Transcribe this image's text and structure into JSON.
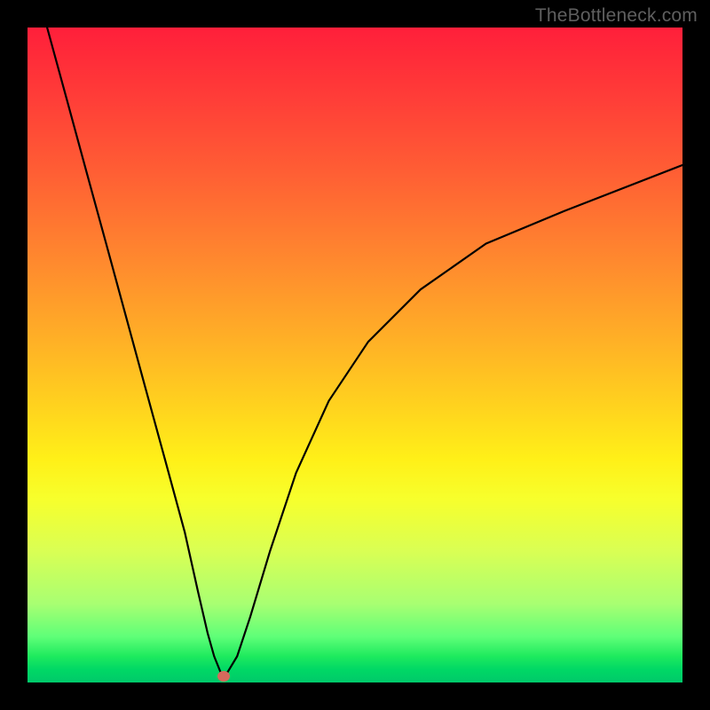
{
  "watermark": "TheBottleneck.com",
  "chart_data": {
    "type": "line",
    "title": "",
    "xlabel": "",
    "ylabel": "",
    "xlim": [
      0,
      100
    ],
    "ylim": [
      0,
      100
    ],
    "grid": false,
    "background_gradient": "red-yellow-green",
    "marker": {
      "x": 30,
      "y": 1
    },
    "series": [
      {
        "name": "bottleneck-curve",
        "x": [
          3,
          6,
          9,
          12,
          15,
          18,
          21,
          24,
          26,
          27.5,
          28.5,
          29.5,
          30.5,
          32,
          34,
          37,
          41,
          46,
          52,
          60,
          70,
          82,
          100
        ],
        "values": [
          100,
          89,
          78,
          67,
          56,
          45,
          34,
          23,
          14,
          7.5,
          4,
          1.5,
          1.5,
          4,
          10,
          20,
          32,
          43,
          52,
          60,
          67,
          72,
          79
        ]
      }
    ]
  }
}
